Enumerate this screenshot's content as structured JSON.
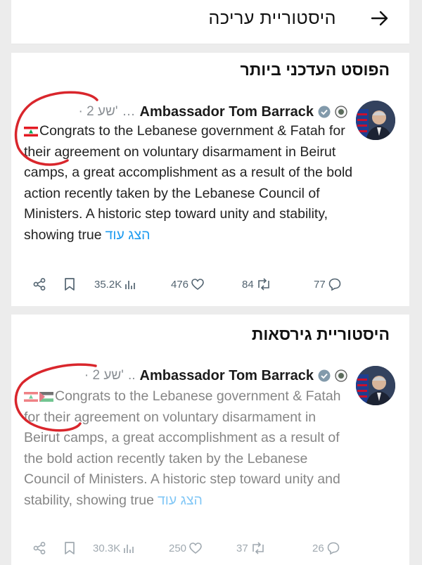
{
  "header": {
    "title": "היסטוריית עריכה",
    "back_icon": "arrow-right-icon"
  },
  "sections": [
    {
      "title": "הפוסט העדכני ביותר"
    },
    {
      "title": "היסטוריית גירסאות"
    }
  ],
  "posts": [
    {
      "author": "Ambassador Tom Barrack",
      "meta": "· 2 שע'",
      "text": "Congrats to the Lebanese government & Fatah for their agreement on voluntary disarmament in Beirut camps, a great accomplishment as a result of the bold action recently taken by the Lebanese Council of Ministers. A historic step toward unity and stability, showing true",
      "show_more": "הצג עוד",
      "flags": [
        "lebanon-flag-icon"
      ],
      "stats": {
        "replies": "77",
        "reposts": "84",
        "likes": "476",
        "views": "35.2K"
      }
    },
    {
      "author": "Ambassador Tom Barrack",
      "meta": "· 2 שע'",
      "text": "Congrats to the Lebanese government & Fatah for their agreement on voluntary disarmament in Beirut camps, a great accomplishment as a result of the bold action recently taken by the Lebanese Council of Ministers. A historic step toward unity and stability, showing true",
      "show_more": "הצג עוד",
      "flags": [
        "lebanon-flag-icon",
        "palestine-flag-icon"
      ],
      "stats": {
        "replies": "26",
        "reposts": "37",
        "likes": "250",
        "views": "30.3K"
      }
    }
  ],
  "colors": {
    "link": "#1d9bf0",
    "annotation": "#d9262c",
    "muted": "#536471"
  }
}
